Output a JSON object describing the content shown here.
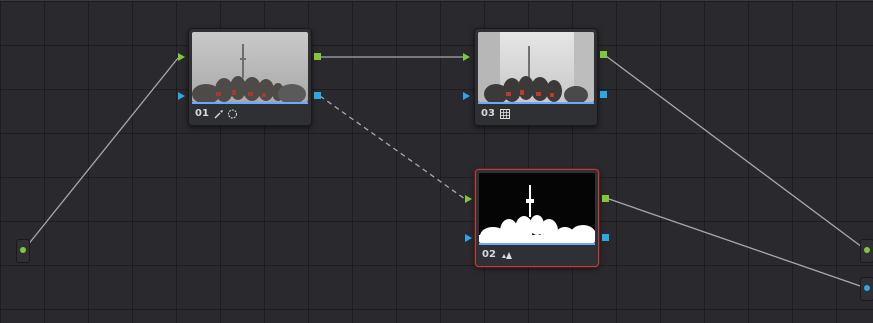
{
  "graph": {
    "nodes": [
      {
        "id": "node-01",
        "label": "01",
        "tools": [
          "qualifier-picker-icon",
          "power-window-circle-icon"
        ],
        "selected": false
      },
      {
        "id": "node-03",
        "label": "03",
        "tools": [
          "grid-icon"
        ],
        "selected": false
      },
      {
        "id": "node-02",
        "label": "02",
        "tools": [
          "3d-qualifier-icon"
        ],
        "selected": true
      }
    ],
    "source_input": {
      "name": "source-input"
    },
    "outputs": [
      {
        "name": "rgb-output"
      },
      {
        "name": "alpha-output"
      }
    ]
  },
  "colors": {
    "canvas": "#2a2a2e",
    "rgb_port": "#7ec83a",
    "key_port": "#2aa7e6",
    "selected_border": "#c33a3a",
    "wire": "#a9a9ad",
    "underline": "#6aa9ff"
  }
}
